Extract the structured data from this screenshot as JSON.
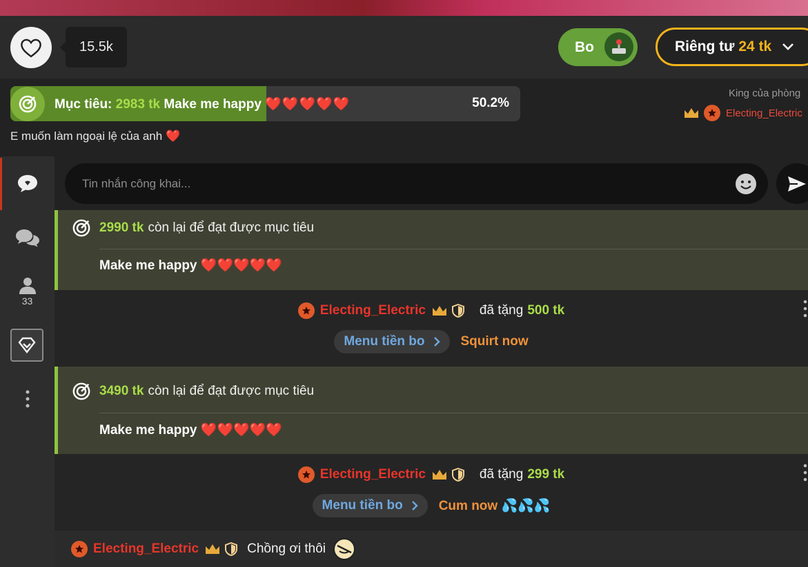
{
  "header": {
    "like_count": "15.5k",
    "tip_label": "Bo",
    "private_label": "Riêng tư",
    "private_price": "24 tk"
  },
  "goal": {
    "label": "Mục tiêu:",
    "amount": "2983 tk",
    "text": "Make me happy",
    "hearts": "❤️❤️❤️❤️❤️",
    "percent_text": "50.2%",
    "progress_fraction": 0.502,
    "subtitle": "E muốn làm ngoại lệ của anh",
    "subtitle_heart": "❤️"
  },
  "king": {
    "label": "King của phòng",
    "username": "Electing_Electric"
  },
  "sidebar": {
    "viewers_count": "33"
  },
  "chat_input": {
    "placeholder": "Tin nhắn công khai..."
  },
  "messages": [
    {
      "type": "goal",
      "amount": "2990 tk",
      "rest": "còn lại để đạt được mục tiêu",
      "goal_text": "Make me happy",
      "hearts": "❤️❤️❤️❤️❤️"
    },
    {
      "type": "tip",
      "username": "Electing_Electric",
      "gave": "đã tặng",
      "amount": "500 tk",
      "menu_label": "Menu tiền bo",
      "action": "Squirt now"
    },
    {
      "type": "goal",
      "amount": "3490 tk",
      "rest": "còn lại để đạt được mục tiêu",
      "goal_text": "Make me happy",
      "hearts": "❤️❤️❤️❤️❤️"
    },
    {
      "type": "tip",
      "username": "Electing_Electric",
      "gave": "đã tặng",
      "amount": "299 tk",
      "menu_label": "Menu tiền bo",
      "action": "Cum now 💦💦💦"
    },
    {
      "type": "chat",
      "username": "Electing_Electric",
      "text": "Chồng ơi thôi"
    }
  ],
  "colors": {
    "accent_green": "#a9dc4a",
    "username_red": "#e8352a",
    "gold": "#f2b21c",
    "tip_button": "#66a13a",
    "link_blue": "#6fa8e0",
    "action_orange": "#f0923a"
  },
  "icons": [
    "heart-icon",
    "joystick-icon",
    "chevron-down-icon",
    "target-icon",
    "crown-icon",
    "star-badge-icon",
    "shield-icon",
    "chat-bubble-icon",
    "chats-icon",
    "user-icon",
    "gift-diamond-icon",
    "more-icon",
    "emoji-icon",
    "send-icon",
    "chevron-right-icon",
    "no-entry-emoji-icon"
  ]
}
